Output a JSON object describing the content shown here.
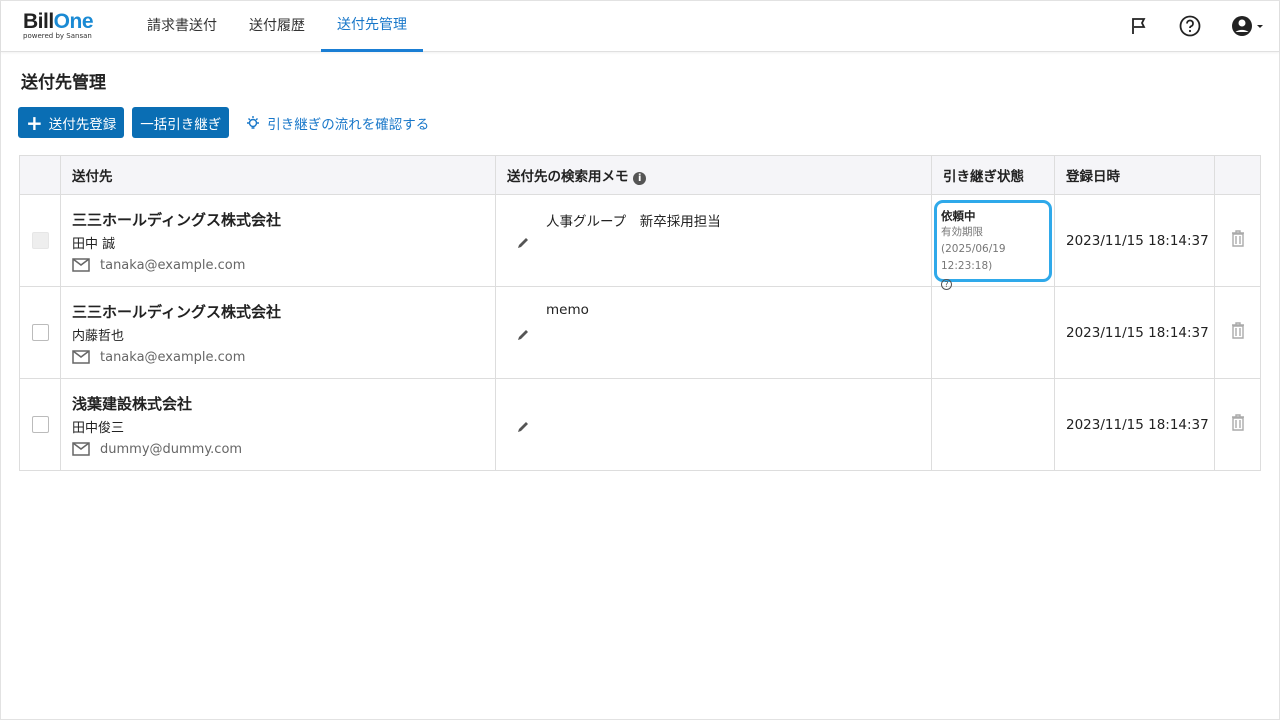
{
  "header": {
    "logo_main": "Bill",
    "logo_accent": "One",
    "logo_sub": "powered by Sansan",
    "nav": [
      {
        "label": "請求書送付"
      },
      {
        "label": "送付履歴"
      },
      {
        "label": "送付先管理"
      }
    ]
  },
  "page_title": "送付先管理",
  "toolbar": {
    "register": "送付先登録",
    "bulk": "一括引き継ぎ",
    "flow_link": "引き継ぎの流れを確認する"
  },
  "table": {
    "headers": {
      "recipient": "送付先",
      "memo": "送付先の検索用メモ",
      "status": "引き継ぎ状態",
      "date": "登録日時"
    },
    "rows": [
      {
        "company": "三三ホールディングス株式会社",
        "person": "田中 誠",
        "email": "tanaka@example.com",
        "memo": "人事グループ　新卒採用担当",
        "status": "依頼中",
        "expiry": "有効期限 (2025/06/19 12:23:18)",
        "date": "2023/11/15 18:14:37"
      },
      {
        "company": "三三ホールディングス株式会社",
        "person": "内藤哲也",
        "email": "tanaka@example.com",
        "memo": "memo",
        "status": "",
        "expiry": "",
        "date": "2023/11/15 18:14:37"
      },
      {
        "company": "浅葉建設株式会社",
        "person": "田中俊三",
        "email": "dummy@dummy.com",
        "memo": "",
        "status": "",
        "expiry": "",
        "date": "2023/11/15 18:14:37"
      }
    ]
  }
}
